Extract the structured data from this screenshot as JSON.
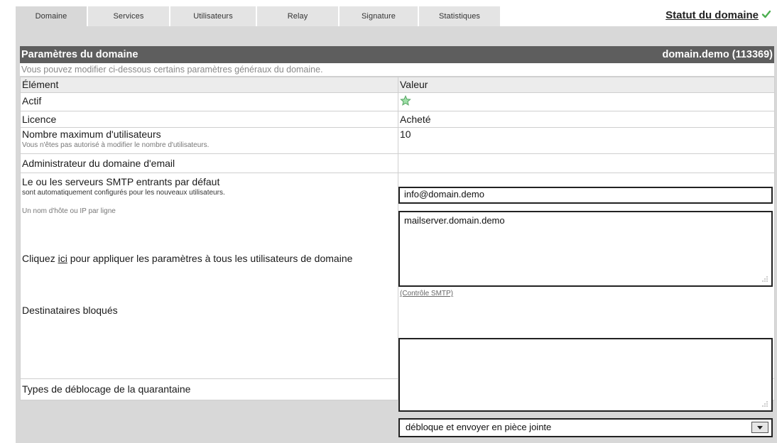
{
  "tabs": [
    {
      "label": "Domaine",
      "active": true
    },
    {
      "label": "Services",
      "active": false
    },
    {
      "label": "Utilisateurs",
      "active": false
    },
    {
      "label": "Relay",
      "active": false
    },
    {
      "label": "Signature",
      "active": false
    },
    {
      "label": "Statistiques",
      "active": false
    }
  ],
  "status": {
    "label": "Statut du domaine",
    "icon": "check-icon",
    "color": "#4caf50"
  },
  "panel": {
    "title": "Paramètres du domaine",
    "domain": "domain.demo (113369)",
    "description": "Vous pouvez modifier ci-dessous certains paramètres généraux du domaine.",
    "columns": {
      "element": "Élément",
      "value": "Valeur"
    }
  },
  "rows": {
    "actif": {
      "label": "Actif",
      "icon": "star-icon"
    },
    "licence": {
      "label": "Licence",
      "value": "Acheté"
    },
    "max_users": {
      "label": "Nombre maximum d'utilisateurs",
      "note": "Vous n'êtes pas autorisé à modifier le nombre d'utilisateurs.",
      "value": "10"
    },
    "admin": {
      "label": "Administrateur du domaine d'email",
      "value": "info@domain.demo"
    },
    "smtp": {
      "label": "Le ou les serveurs SMTP entrants par défaut",
      "note": "sont automatiquement configurés pour les nouveaux utilisateurs.",
      "hint": "Un nom d'hôte ou IP par ligne",
      "value": "mailserver.domain.demo",
      "check_link": "(Contrôle SMTP)"
    },
    "apply": {
      "prefix": "Cliquez ",
      "link": "ici",
      "suffix": " pour appliquer les paramètres à tous les utilisateurs de domaine"
    },
    "blocked": {
      "label": "Destinataires bloqués",
      "value": ""
    },
    "quarantine": {
      "label": "Types de déblocage de la quarantaine",
      "value": "débloque et envoyer en pièce jointe"
    }
  }
}
